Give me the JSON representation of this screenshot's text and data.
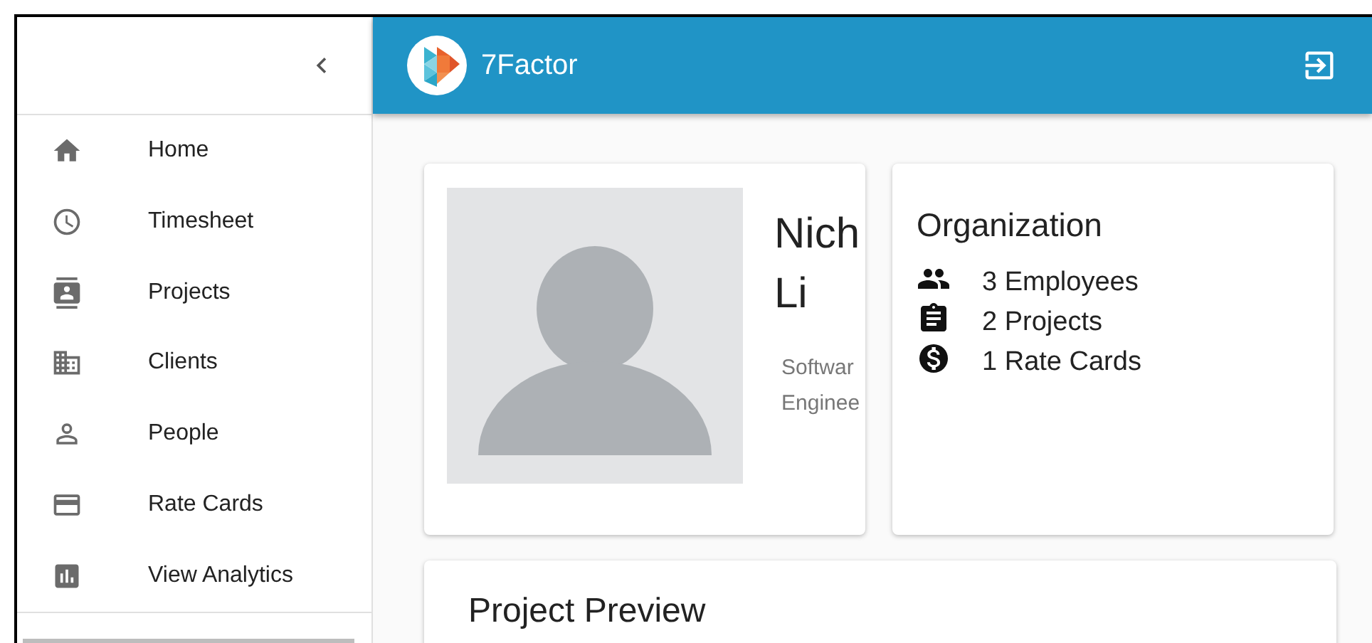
{
  "app_bar": {
    "brand": "7Factor"
  },
  "sidebar": {
    "items": [
      {
        "label": "Home"
      },
      {
        "label": "Timesheet"
      },
      {
        "label": "Projects"
      },
      {
        "label": "Clients"
      },
      {
        "label": "People"
      },
      {
        "label": "Rate Cards"
      },
      {
        "label": "View Analytics"
      }
    ]
  },
  "profile": {
    "name_lines": [
      "Nich",
      "Li"
    ],
    "title_lines": [
      "Softwar",
      "Enginee"
    ]
  },
  "organization": {
    "title": "Organization",
    "stats": [
      {
        "label": "3 Employees"
      },
      {
        "label": "2 Projects"
      },
      {
        "label": "1 Rate Cards"
      }
    ]
  },
  "project_preview": {
    "title": "Project Preview"
  }
}
